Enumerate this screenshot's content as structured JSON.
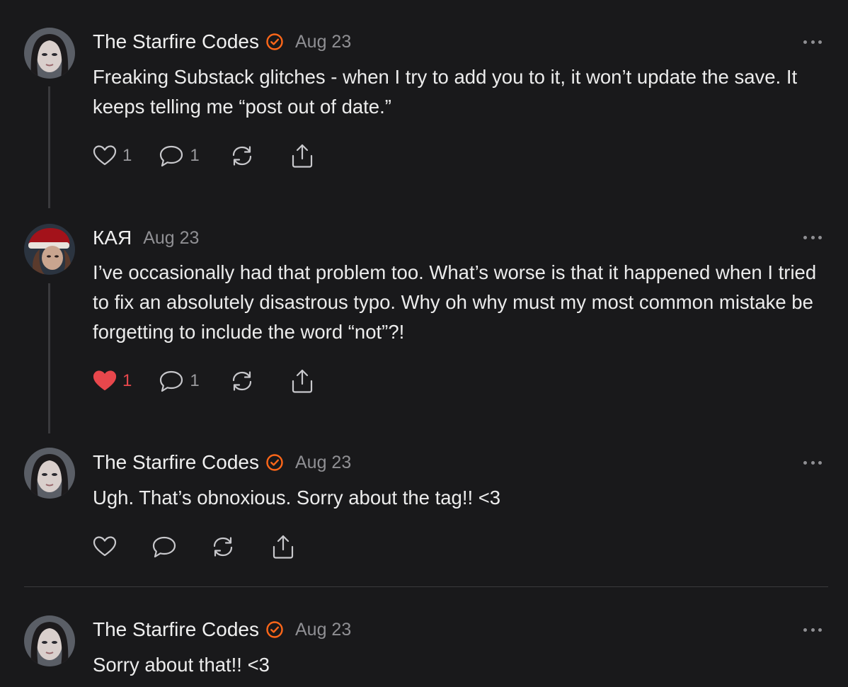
{
  "comments": [
    {
      "author": "The Starfire Codes",
      "verified": true,
      "date": "Aug 23",
      "text": "Freaking Substack glitches - when I try to add you to it, it won’t update the save. It keeps telling me “post out of date.”",
      "likes": "1",
      "replies": "1",
      "liked": false,
      "avatar": "starfire-avatar"
    },
    {
      "author": "КАЯ",
      "verified": false,
      "date": "Aug 23",
      "text": "I’ve occasionally had that problem too. What’s worse is that it happened when I tried to fix an absolutely disastrous typo. Why oh why must my most common mistake be forgetting to include the word “not”?!",
      "likes": "1",
      "replies": "1",
      "liked": true,
      "avatar": "kaya-avatar"
    },
    {
      "author": "The Starfire Codes",
      "verified": true,
      "date": "Aug 23",
      "text": "Ugh. That’s obnoxious. Sorry about the tag!! <3",
      "likes": "",
      "replies": "",
      "liked": false,
      "avatar": "starfire-avatar"
    },
    {
      "author": "The Starfire Codes",
      "verified": true,
      "date": "Aug 23",
      "text": "Sorry about that!! <3",
      "avatar": "starfire-avatar"
    }
  ],
  "icons": {
    "like": "heart-icon",
    "reply": "comment-bubble-icon",
    "restack": "restack-icon",
    "share": "share-icon",
    "more": "more-options-icon",
    "verified": "verified-badge-icon"
  },
  "colors": {
    "background": "#19191b",
    "verified": "#ff6719",
    "liked": "#e8474c",
    "muted": "#8f8f93"
  }
}
